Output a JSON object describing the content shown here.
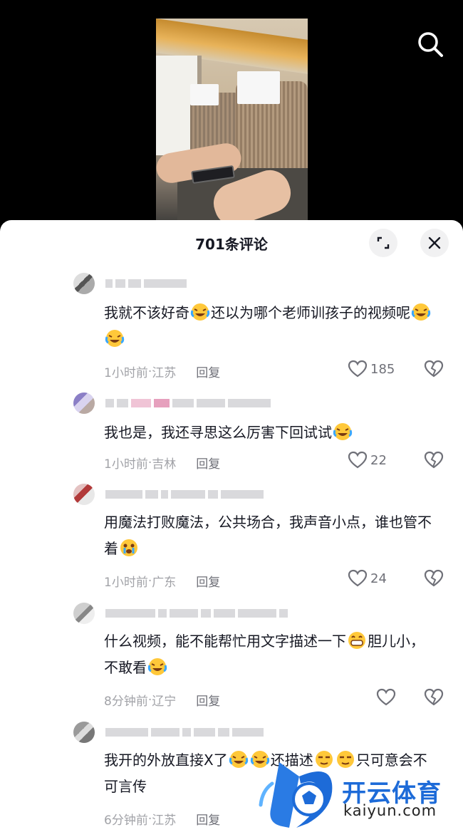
{
  "header": {
    "title": "701条评论"
  },
  "comments": [
    {
      "text": "我就不该好奇",
      "text_after": "还以为哪个老师训孩子的视频呢",
      "time": "1小时前",
      "location": "江苏",
      "reply": "回复",
      "likes": "185"
    },
    {
      "text": "我也是，我还寻思这么厉害下回试试",
      "time": "1小时前",
      "location": "吉林",
      "reply": "回复",
      "likes": "22"
    },
    {
      "text": "用魔法打败魔法，公共场合，我声音小点，谁也管不着",
      "time": "1小时前",
      "location": "广东",
      "reply": "回复",
      "likes": "24"
    },
    {
      "text": "什么视频，能不能帮忙用文字描述一下",
      "text_after": "胆儿小，不敢看",
      "time": "8分钟前",
      "location": "辽宁",
      "reply": "回复",
      "likes": ""
    },
    {
      "text": "我开的外放直接X了",
      "text_mid": "还描述",
      "text_after": "只可意会不可言传",
      "time": "6分钟前",
      "location": "江苏",
      "reply": "回复",
      "likes": ""
    }
  ],
  "meta_separator": " · ",
  "watermark": {
    "text": "开云体育",
    "url": "kaiyun.com"
  },
  "icons": {
    "search": "search-icon",
    "expand": "expand-icon",
    "close": "close-icon",
    "like": "heart-icon",
    "dislike": "broken-heart-icon",
    "emoji_laugh": "laugh-cry-emoji",
    "emoji_grin": "grin-emoji",
    "emoji_cry": "crying-emoji",
    "emoji_smirk": "smirk-emoji"
  },
  "colors": {
    "sheet": "#ffffff",
    "text": "#161823",
    "meta": "#a1a2a7",
    "brand": "#1d6bd8"
  }
}
